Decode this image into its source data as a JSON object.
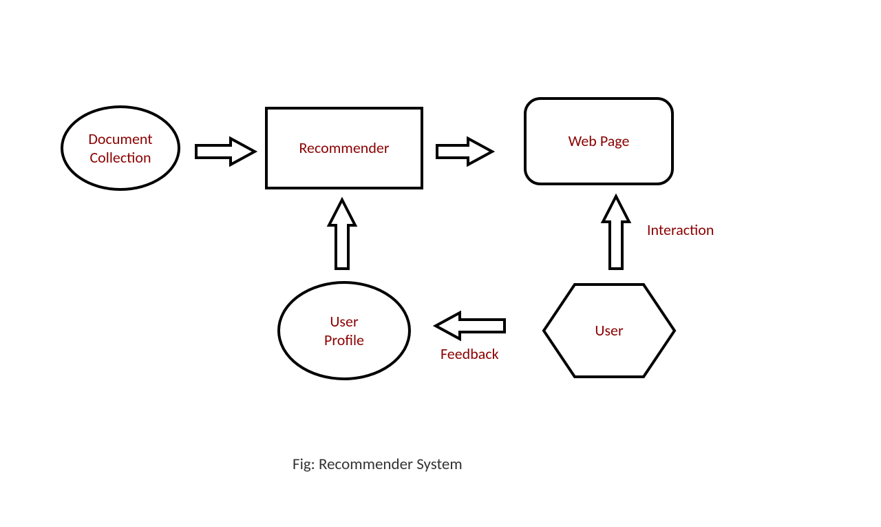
{
  "nodes": {
    "document_collection": {
      "line1": "Document",
      "line2": "Collection"
    },
    "recommender": "Recommender",
    "web_page": "Web Page",
    "user_profile": {
      "line1": "User",
      "line2": "Profile"
    },
    "user": "User"
  },
  "arrows": {
    "interaction": "Interaction",
    "feedback": "Feedback"
  },
  "caption": "Fig: Recommender System"
}
